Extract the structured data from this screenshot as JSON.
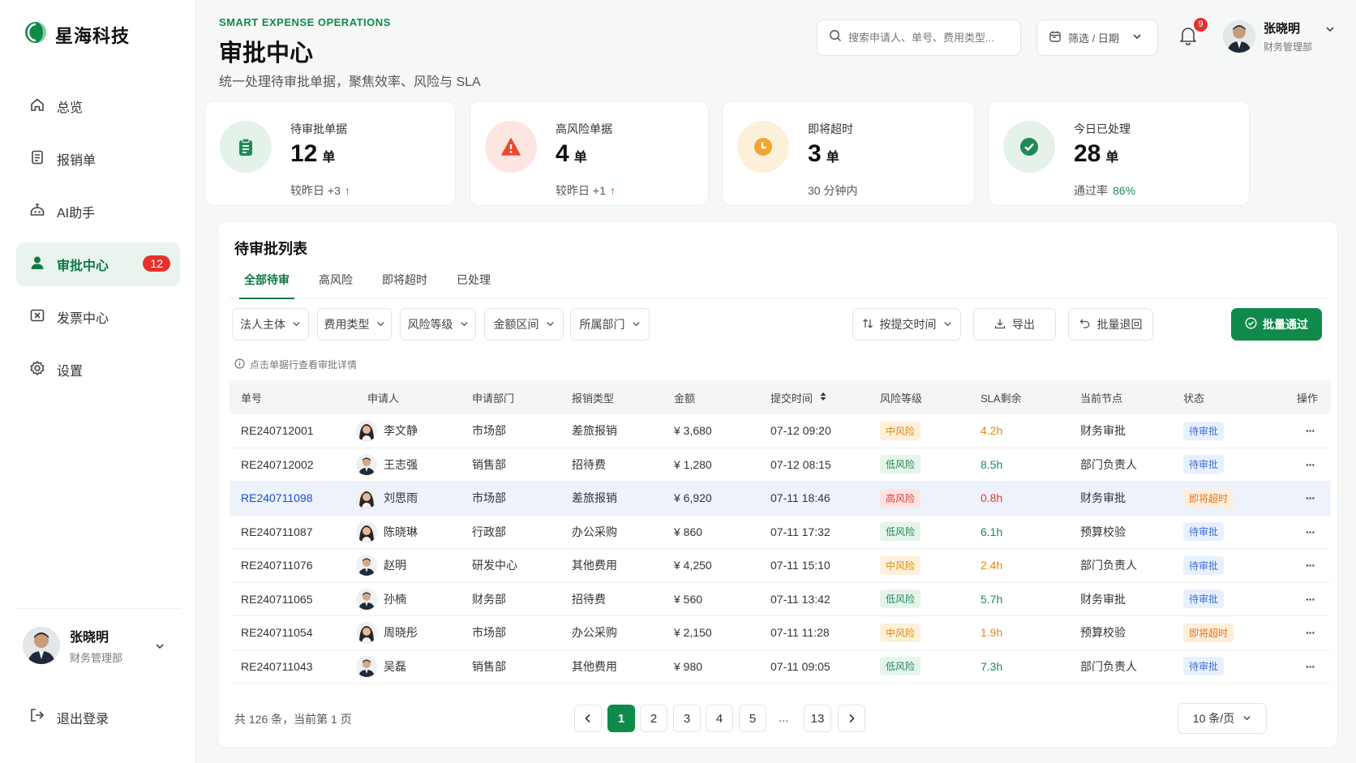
{
  "brand": {
    "name": "星海科技",
    "accent": "#0f8a4b"
  },
  "sidebar": {
    "items": [
      {
        "label": "总览",
        "icon": "home-icon"
      },
      {
        "label": "报销单",
        "icon": "document-icon"
      },
      {
        "label": "AI助手",
        "icon": "robot-icon"
      },
      {
        "label": "审批中心",
        "icon": "user-icon",
        "badge": "12",
        "active": true
      },
      {
        "label": "发票中心",
        "icon": "invoice-icon"
      },
      {
        "label": "设置",
        "icon": "gear-icon"
      }
    ],
    "user": {
      "name": "张晓明",
      "dept": "财务管理部"
    },
    "logout": "退出登录"
  },
  "header": {
    "eyebrow": "SMART EXPENSE OPERATIONS",
    "title": "审批中心",
    "subtitle": "统一处理待审批单据，聚焦效率、风险与 SLA",
    "search_placeholder": "搜索申请人、单号、费用类型...",
    "filter_label": "筛选 / 日期",
    "notification_count": "9",
    "user": {
      "name": "张晓明",
      "dept": "财务管理部"
    }
  },
  "stats": [
    {
      "label": "待审批单据",
      "value": "12",
      "unit": "单",
      "sub": "较昨日 +3",
      "trend": "↑",
      "color": "#1f8a55",
      "icon": "clipboard-icon"
    },
    {
      "label": "高风险单据",
      "value": "4",
      "unit": "单",
      "sub": "较昨日 +1",
      "trend": "↑",
      "color": "#e84a2b",
      "icon": "warning-icon"
    },
    {
      "label": "即将超时",
      "value": "3",
      "unit": "单",
      "sub": "30 分钟内",
      "trend": "",
      "color": "#f2a531",
      "icon": "clock-icon"
    },
    {
      "label": "今日已处理",
      "value": "28",
      "unit": "单",
      "sub": "通过率",
      "sub_highlight": "86%",
      "color": "#1f8a55",
      "icon": "check-circle-icon"
    }
  ],
  "list": {
    "title": "待审批列表",
    "tabs": [
      "全部待审",
      "高风险",
      "即将超时",
      "已处理"
    ],
    "filters": [
      "法人主体",
      "费用类型",
      "风险等级",
      "金额区间",
      "所属部门"
    ],
    "sort_label": "按提交时间",
    "export_label": "导出",
    "reject_label": "批量退回",
    "approve_label": "批量通过",
    "hint": "点击单据行查看审批详情",
    "columns": [
      "单号",
      "申请人",
      "申请部门",
      "报销类型",
      "金额",
      "提交时间",
      "风险等级",
      "SLA剩余",
      "当前节点",
      "状态",
      "操作"
    ],
    "rows": [
      {
        "id": "RE240712001",
        "applicant": "李文静",
        "gender": "f",
        "dept": "市场部",
        "type": "差旅报销",
        "amount": "¥ 3,680",
        "time": "07-12 09:20",
        "risk": "中风险",
        "risk_level": "mid",
        "sla": "4.2h",
        "node": "财务审批",
        "status": "待审批",
        "status_kind": "pending"
      },
      {
        "id": "RE240712002",
        "applicant": "王志强",
        "gender": "m",
        "dept": "销售部",
        "type": "招待费",
        "amount": "¥ 1,280",
        "time": "07-12 08:15",
        "risk": "低风险",
        "risk_level": "low",
        "sla": "8.5h",
        "node": "部门负责人",
        "status": "待审批",
        "status_kind": "pending"
      },
      {
        "id": "RE240711098",
        "applicant": "刘思雨",
        "gender": "f",
        "dept": "市场部",
        "type": "差旅报销",
        "amount": "¥ 6,920",
        "time": "07-11 18:46",
        "risk": "高风险",
        "risk_level": "high",
        "sla": "0.8h",
        "node": "财务审批",
        "status": "即将超时",
        "status_kind": "due",
        "highlight": true
      },
      {
        "id": "RE240711087",
        "applicant": "陈晓琳",
        "gender": "f",
        "dept": "行政部",
        "type": "办公采购",
        "amount": "¥ 860",
        "time": "07-11 17:32",
        "risk": "低风险",
        "risk_level": "low",
        "sla": "6.1h",
        "node": "预算校验",
        "status": "待审批",
        "status_kind": "pending"
      },
      {
        "id": "RE240711076",
        "applicant": "赵明",
        "gender": "m",
        "dept": "研发中心",
        "type": "其他费用",
        "amount": "¥ 4,250",
        "time": "07-11 15:10",
        "risk": "中风险",
        "risk_level": "mid",
        "sla": "2.4h",
        "node": "部门负责人",
        "status": "待审批",
        "status_kind": "pending"
      },
      {
        "id": "RE240711065",
        "applicant": "孙楠",
        "gender": "m",
        "dept": "财务部",
        "type": "招待费",
        "amount": "¥ 560",
        "time": "07-11 13:42",
        "risk": "低风险",
        "risk_level": "low",
        "sla": "5.7h",
        "node": "财务审批",
        "status": "待审批",
        "status_kind": "pending"
      },
      {
        "id": "RE240711054",
        "applicant": "周晓彤",
        "gender": "f",
        "dept": "市场部",
        "type": "办公采购",
        "amount": "¥ 2,150",
        "time": "07-11 11:28",
        "risk": "中风险",
        "risk_level": "mid",
        "sla": "1.9h",
        "node": "预算校验",
        "status": "即将超时",
        "status_kind": "due"
      },
      {
        "id": "RE240711043",
        "applicant": "吴磊",
        "gender": "m",
        "dept": "销售部",
        "type": "其他费用",
        "amount": "¥ 980",
        "time": "07-11 09:05",
        "risk": "低风险",
        "risk_level": "low",
        "sla": "7.3h",
        "node": "部门负责人",
        "status": "待审批",
        "status_kind": "pending"
      }
    ],
    "actions_glyph": "···"
  },
  "pagination": {
    "total_text": "共 126 条，当前第 1 页",
    "pages": [
      "1",
      "2",
      "3",
      "4",
      "5",
      "...",
      "13"
    ],
    "current": "1",
    "page_size": "10 条/页"
  },
  "colors": {
    "risk_low_bg": "#e6f5ec",
    "risk_low_fg": "#1f8a55",
    "risk_mid_bg": "#fdf1dc",
    "risk_mid_fg": "#e08a0b",
    "risk_high_bg": "#fde4e2",
    "risk_high_fg": "#e0392f",
    "status_pending_bg": "#e8f0fd",
    "status_pending_fg": "#3c6fd8",
    "status_due_bg": "#fdeedd",
    "status_due_fg": "#e8741b",
    "link": "#1d4ed8"
  }
}
